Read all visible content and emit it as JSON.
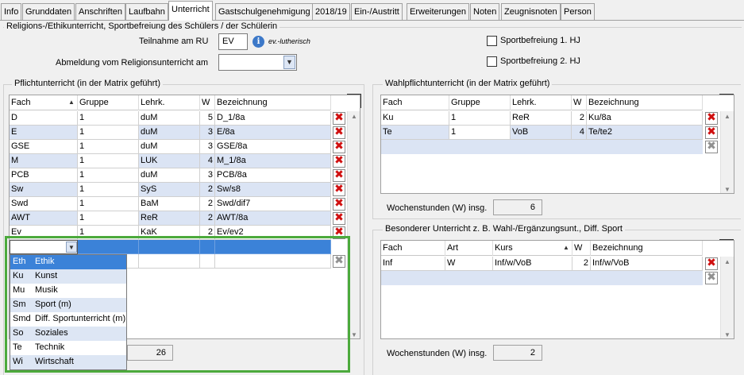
{
  "tabs": [
    "Info",
    "Grunddaten",
    "Anschriften",
    "Laufbahn",
    "Unterricht",
    "Gastschulgenehmigung",
    "2018/19",
    "Ein-/Austritt",
    "Erweiterungen",
    "Noten",
    "Zeugnisnoten",
    "Person"
  ],
  "religion": {
    "title": "Religions-/Ethikunterricht, Sportbefreiung des Schülers / der Schülerin",
    "teilnahme_label": "Teilnahme am RU",
    "teilnahme_value": "EV",
    "teilnahme_info": "ev.-lutherisch",
    "abmeldung_label": "Abmeldung vom Religionsunterricht am",
    "abmeldung_value": "",
    "sport1": "Sportbefreiung 1. HJ",
    "sport2": "Sportbefreiung 2. HJ"
  },
  "pflicht": {
    "title": "Pflichtunterricht (in der Matrix geführt)",
    "headers": [
      "Fach",
      "Gruppe",
      "Lehrk.",
      "W",
      "Bezeichnung"
    ],
    "rows": [
      [
        "D",
        "1",
        "duM",
        "5",
        "D_1/8a"
      ],
      [
        "E",
        "1",
        "duM",
        "3",
        "E/8a"
      ],
      [
        "GSE",
        "1",
        "duM",
        "3",
        "GSE/8a"
      ],
      [
        "M",
        "1",
        "LUK",
        "4",
        "M_1/8a"
      ],
      [
        "PCB",
        "1",
        "duM",
        "3",
        "PCB/8a"
      ],
      [
        "Sw",
        "1",
        "SyS",
        "2",
        "Sw/s8"
      ],
      [
        "Swd",
        "1",
        "BaM",
        "2",
        "Swd/dif7"
      ],
      [
        "AWT",
        "1",
        "ReR",
        "2",
        "AWT/8a"
      ],
      [
        "Ev",
        "1",
        "KaK",
        "2",
        "Ev/ev2"
      ]
    ],
    "total": "26"
  },
  "dropdown": [
    [
      "Eth",
      "Ethik"
    ],
    [
      "Ku",
      "Kunst"
    ],
    [
      "Mu",
      "Musik"
    ],
    [
      "Sm",
      "Sport (m)"
    ],
    [
      "Smd",
      "Diff. Sportunterricht (m)"
    ],
    [
      "So",
      "Soziales"
    ],
    [
      "Te",
      "Technik"
    ],
    [
      "Wi",
      "Wirtschaft"
    ]
  ],
  "wahl": {
    "title": "Wahlpflichtunterricht (in der Matrix geführt)",
    "headers": [
      "Fach",
      "Gruppe",
      "Lehrk.",
      "W",
      "Bezeichnung"
    ],
    "rows": [
      [
        "Ku",
        "1",
        "ReR",
        "2",
        "Ku/8a"
      ],
      [
        "Te",
        "1",
        "VoB",
        "4",
        "Te/te2"
      ]
    ],
    "sum_label": "Wochenstunden (W) insg.",
    "sum_value": "6"
  },
  "besonder": {
    "title": "Besonderer Unterricht z. B. Wahl-/Ergänzungsunt., Diff. Sport",
    "headers": [
      "Fach",
      "Art",
      "Kurs",
      "W",
      "Bezeichnung"
    ],
    "rows": [
      [
        "Inf",
        "W",
        "Inf/w/VoB",
        "2",
        "Inf/w/VoB"
      ]
    ],
    "sum_label": "Wochenstunden (W) insg.",
    "sum_value": "2"
  },
  "icons": {
    "delete": "delete-x-icon",
    "config": "column-config-icon",
    "info": "info-icon",
    "dropdown": "chevron-down-icon",
    "sort": "sort-asc-icon"
  },
  "colors": {
    "row_alt": "#dbe4f4",
    "selected": "#3b82d8",
    "delete": "#d01010",
    "highlight": "#4caa3c"
  }
}
